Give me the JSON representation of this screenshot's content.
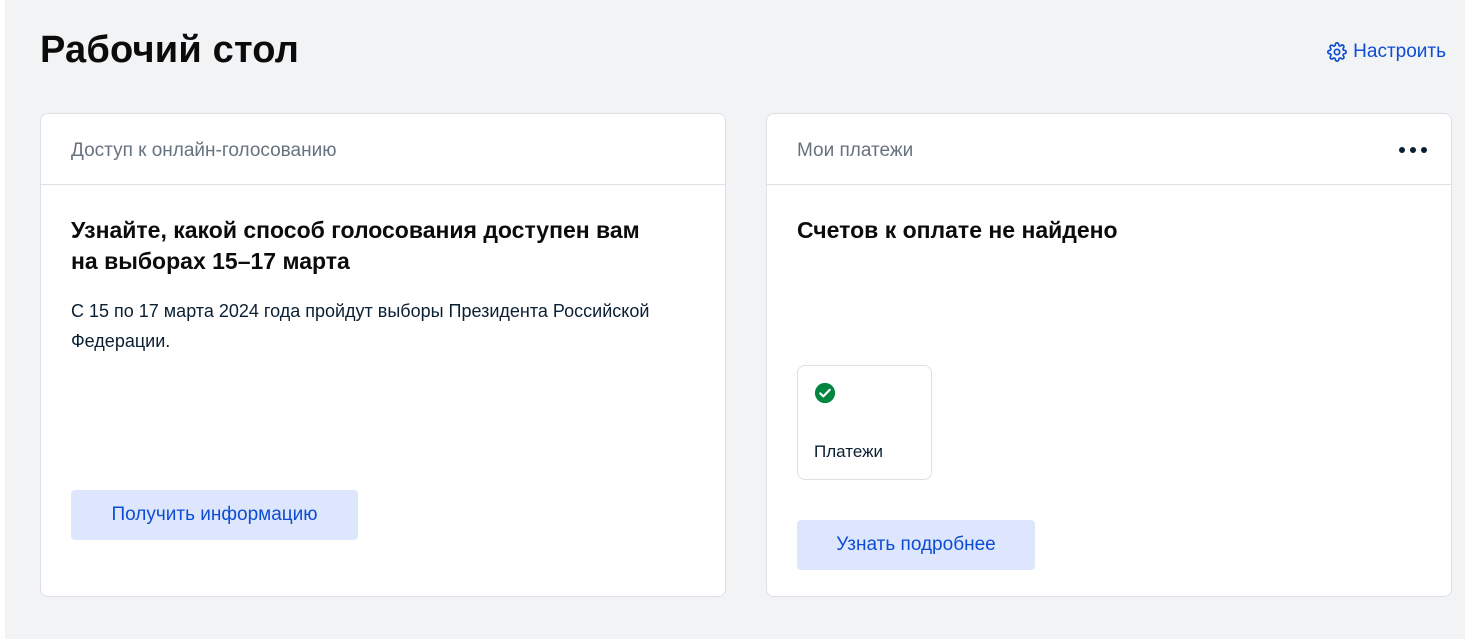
{
  "header": {
    "title": "Рабочий стол",
    "settings_label": "Настроить",
    "settings_icon": "gear-icon"
  },
  "voting_card": {
    "header_title": "Доступ к онлайн-голосованию",
    "heading": "Узнайте, какой способ голосования доступен вам на выборах 15–17 марта",
    "text": "С 15 по 17 марта 2024 года пройдут выборы Президента Российской Федерации.",
    "button_label": "Получить информацию"
  },
  "payments_card": {
    "header_title": "Мои платежи",
    "more_icon": "more-dots-icon",
    "heading": "Счетов к оплате не найдено",
    "tile_label": "Платежи",
    "tile_icon": "check-circle-icon",
    "button_label": "Узнать подробнее"
  },
  "colors": {
    "background": "#f2f3f5",
    "card": "#ffffff",
    "accent": "#0d4cd3",
    "button_bg": "#dde6fc",
    "success": "#00863f"
  }
}
